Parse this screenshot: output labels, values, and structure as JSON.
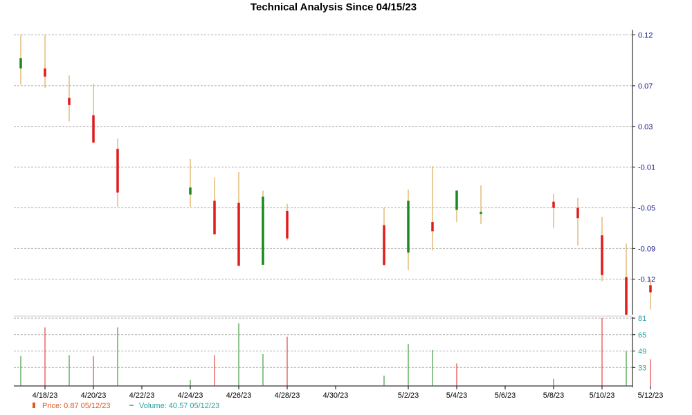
{
  "chart_data": {
    "type": "candlestick",
    "title": "Technical Analysis Since 04/15/23",
    "colors": {
      "up": "#1a8a1a",
      "down": "#e01b1b",
      "wick": "#d49a3a",
      "grid": "#aaaaaa",
      "price_axis": "#1a1a8c",
      "volume_axis": "#2aa1a1"
    },
    "price_axis": {
      "ylim": [
        -0.155,
        0.125
      ],
      "ticks": [
        0.12,
        0.07,
        0.03,
        -0.01,
        -0.05,
        -0.09,
        -0.12
      ]
    },
    "volume_axis": {
      "ylim": [
        15,
        81
      ],
      "ticks": [
        81,
        65,
        49,
        33
      ]
    },
    "x_tick_labels": [
      "4/18/23",
      "4/20/23",
      "4/22/23",
      "4/24/23",
      "4/26/23",
      "4/28/23",
      "4/30/23",
      "5/2/23",
      "5/4/23",
      "5/6/23",
      "5/8/23",
      "5/10/23",
      "5/12/23"
    ],
    "candles": [
      {
        "date": "4/17/23",
        "open": 0.087,
        "high": 0.12,
        "low": 0.071,
        "close": 0.097
      },
      {
        "date": "4/18/23",
        "open": 0.087,
        "high": 0.12,
        "low": 0.068,
        "close": 0.079
      },
      {
        "date": "4/19/23",
        "open": 0.058,
        "high": 0.08,
        "low": 0.035,
        "close": 0.051
      },
      {
        "date": "4/20/23",
        "open": 0.041,
        "high": 0.072,
        "low": 0.022,
        "close": 0.014
      },
      {
        "date": "4/21/23",
        "open": 0.008,
        "high": 0.018,
        "low": -0.049,
        "close": -0.035
      },
      {
        "date": "4/24/23",
        "open": -0.037,
        "high": -0.002,
        "low": -0.049,
        "close": -0.03
      },
      {
        "date": "4/25/23",
        "open": -0.043,
        "high": -0.02,
        "low": -0.068,
        "close": -0.076
      },
      {
        "date": "4/26/23",
        "open": -0.045,
        "high": -0.015,
        "low": -0.105,
        "close": -0.107
      },
      {
        "date": "4/27/23",
        "open": -0.106,
        "high": -0.033,
        "low": -0.1,
        "close": -0.039
      },
      {
        "date": "4/28/23",
        "open": -0.053,
        "high": -0.046,
        "low": -0.082,
        "close": -0.08
      },
      {
        "date": "5/1/23",
        "open": -0.067,
        "high": -0.05,
        "low": -0.107,
        "close": -0.106
      },
      {
        "date": "5/2/23",
        "open": -0.094,
        "high": -0.032,
        "low": -0.111,
        "close": -0.043
      },
      {
        "date": "5/3/23",
        "open": -0.064,
        "high": -0.009,
        "low": -0.092,
        "close": -0.073
      },
      {
        "date": "5/4/23",
        "open": -0.052,
        "high": -0.034,
        "low": -0.064,
        "close": -0.033
      },
      {
        "date": "5/5/23",
        "open": -0.056,
        "high": -0.028,
        "low": -0.066,
        "close": -0.054
      },
      {
        "date": "5/8/23",
        "open": -0.044,
        "high": -0.036,
        "low": -0.07,
        "close": -0.05
      },
      {
        "date": "5/9/23",
        "open": -0.05,
        "high": -0.04,
        "low": -0.087,
        "close": -0.06
      },
      {
        "date": "5/10/23",
        "open": -0.077,
        "high": -0.059,
        "low": -0.122,
        "close": -0.116
      },
      {
        "date": "5/11/23",
        "open": -0.118,
        "high": -0.085,
        "low": -0.15,
        "close": -0.155
      },
      {
        "date": "5/12/23",
        "open": -0.126,
        "high": -0.12,
        "low": -0.15,
        "close": -0.133
      }
    ],
    "volume": [
      {
        "date": "4/17/23",
        "value": 44,
        "direction": "up"
      },
      {
        "date": "4/18/23",
        "value": 72,
        "direction": "down"
      },
      {
        "date": "4/19/23",
        "value": 45,
        "direction": "up"
      },
      {
        "date": "4/20/23",
        "value": 44,
        "direction": "down"
      },
      {
        "date": "4/21/23",
        "value": 72,
        "direction": "up"
      },
      {
        "date": "4/24/23",
        "value": 21,
        "direction": "up"
      },
      {
        "date": "4/25/23",
        "value": 45,
        "direction": "down"
      },
      {
        "date": "4/26/23",
        "value": 76,
        "direction": "up"
      },
      {
        "date": "4/27/23",
        "value": 46,
        "direction": "up"
      },
      {
        "date": "4/28/23",
        "value": 63,
        "direction": "down"
      },
      {
        "date": "5/1/23",
        "value": 25,
        "direction": "up"
      },
      {
        "date": "5/2/23",
        "value": 56,
        "direction": "up"
      },
      {
        "date": "5/3/23",
        "value": 50,
        "direction": "up"
      },
      {
        "date": "5/4/23",
        "value": 37,
        "direction": "down"
      },
      {
        "date": "5/8/23",
        "value": 22,
        "direction": "up"
      },
      {
        "date": "5/10/23",
        "value": 81,
        "direction": "down"
      },
      {
        "date": "5/11/23",
        "value": 49,
        "direction": "up"
      },
      {
        "date": "5/12/23",
        "value": 41,
        "direction": "down"
      }
    ],
    "legend": {
      "position": "bottom-left",
      "price_label": "Price: 0.87  05/12/23",
      "volume_label": "Volume: 40.57  05/12/23",
      "price_color": "#e05a1b",
      "volume_color": "#2aa1a1"
    }
  }
}
